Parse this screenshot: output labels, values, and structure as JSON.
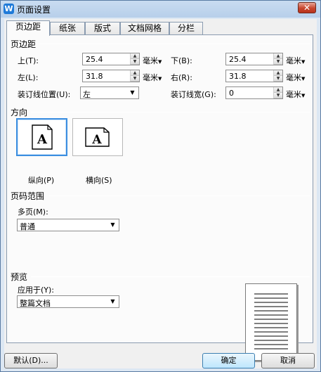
{
  "window": {
    "title": "页面设置",
    "app_icon": "W",
    "close_glyph": "✕"
  },
  "tabs": [
    {
      "label": "页边距",
      "active": true
    },
    {
      "label": "纸张",
      "active": false
    },
    {
      "label": "版式",
      "active": false
    },
    {
      "label": "文档网格",
      "active": false
    },
    {
      "label": "分栏",
      "active": false
    }
  ],
  "margins": {
    "section_title": "页边距",
    "top_label": "上(T):",
    "top_value": "25.4",
    "bottom_label": "下(B):",
    "bottom_value": "25.4",
    "left_label": "左(L):",
    "left_value": "31.8",
    "right_label": "右(R):",
    "right_value": "31.8",
    "gutter_pos_label": "装订线位置(U):",
    "gutter_pos_value": "左",
    "gutter_width_label": "装订线宽(G):",
    "gutter_width_value": "0",
    "unit": "毫米"
  },
  "orientation": {
    "section_title": "方向",
    "portrait_label": "纵向(P)",
    "landscape_label": "横向(S)",
    "glyph": "A",
    "selected": "portrait"
  },
  "pages": {
    "section_title": "页码范围",
    "multiple_label": "多页(M):",
    "multiple_value": "普通"
  },
  "preview": {
    "section_title": "预览",
    "apply_label": "应用于(Y):",
    "apply_value": "整篇文档"
  },
  "buttons": {
    "default": "默认(D)...",
    "ok": "确定",
    "cancel": "取消"
  }
}
